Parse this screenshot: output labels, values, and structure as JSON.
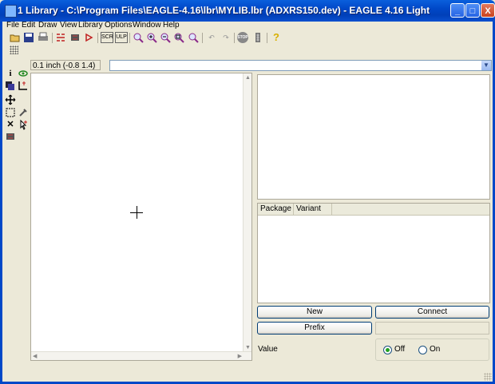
{
  "window": {
    "title": "1 Library - C:\\Program Files\\EAGLE-4.16\\lbr\\MYLIB.lbr (ADXRS150.dev) - EAGLE 4.16 Light",
    "minimize": "_",
    "maximize": "□",
    "close": "X"
  },
  "menu": {
    "items": [
      "File",
      "Edit",
      "Draw",
      "View",
      "Library",
      "Options",
      "Window",
      "Help"
    ]
  },
  "toolbar": {
    "icons": [
      "open-icon",
      "save-icon",
      "print-icon",
      "schematic-icon",
      "board-icon",
      "use-icon",
      "script-icon",
      "run-ulp-icon",
      "zoom-fit-icon",
      "zoom-in-icon",
      "zoom-out-icon",
      "zoom-select-icon",
      "redraw-icon",
      "undo-icon",
      "redo-icon",
      "stop-icon",
      "go-icon",
      "help-icon"
    ],
    "labels": {
      "script": "SCR",
      "ulp": "ULP",
      "stop": "STOP",
      "help": "?"
    }
  },
  "coordbar": {
    "grid_readout": "0.1 inch (-0.8 1.4)",
    "command_value": ""
  },
  "packages": {
    "columns": [
      "Package",
      "Variant"
    ],
    "rows": []
  },
  "buttons": {
    "new": "New",
    "connect": "Connect",
    "prefix": "Prefix"
  },
  "value": {
    "label": "Value",
    "off": "Off",
    "on": "On",
    "selected": "Off"
  }
}
